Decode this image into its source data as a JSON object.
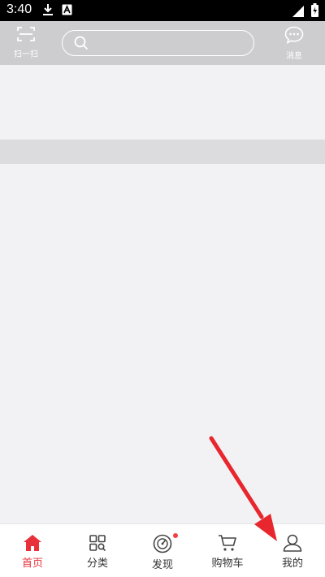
{
  "status_bar": {
    "time": "3:40"
  },
  "header": {
    "scan_label": "扫一扫",
    "message_label": "消息",
    "search_placeholder": ""
  },
  "bottom_nav": {
    "items": [
      {
        "label": "首页",
        "icon": "home-icon",
        "active": true
      },
      {
        "label": "分类",
        "icon": "category-icon",
        "active": false
      },
      {
        "label": "发现",
        "icon": "discover-icon",
        "active": false,
        "badge_dot": true
      },
      {
        "label": "购物车",
        "icon": "cart-icon",
        "active": false
      },
      {
        "label": "我的",
        "icon": "profile-icon",
        "active": false
      }
    ]
  },
  "colors": {
    "accent": "#e8303a",
    "header_bg": "#cdcdd0",
    "annotation_arrow": "#e8262e"
  }
}
